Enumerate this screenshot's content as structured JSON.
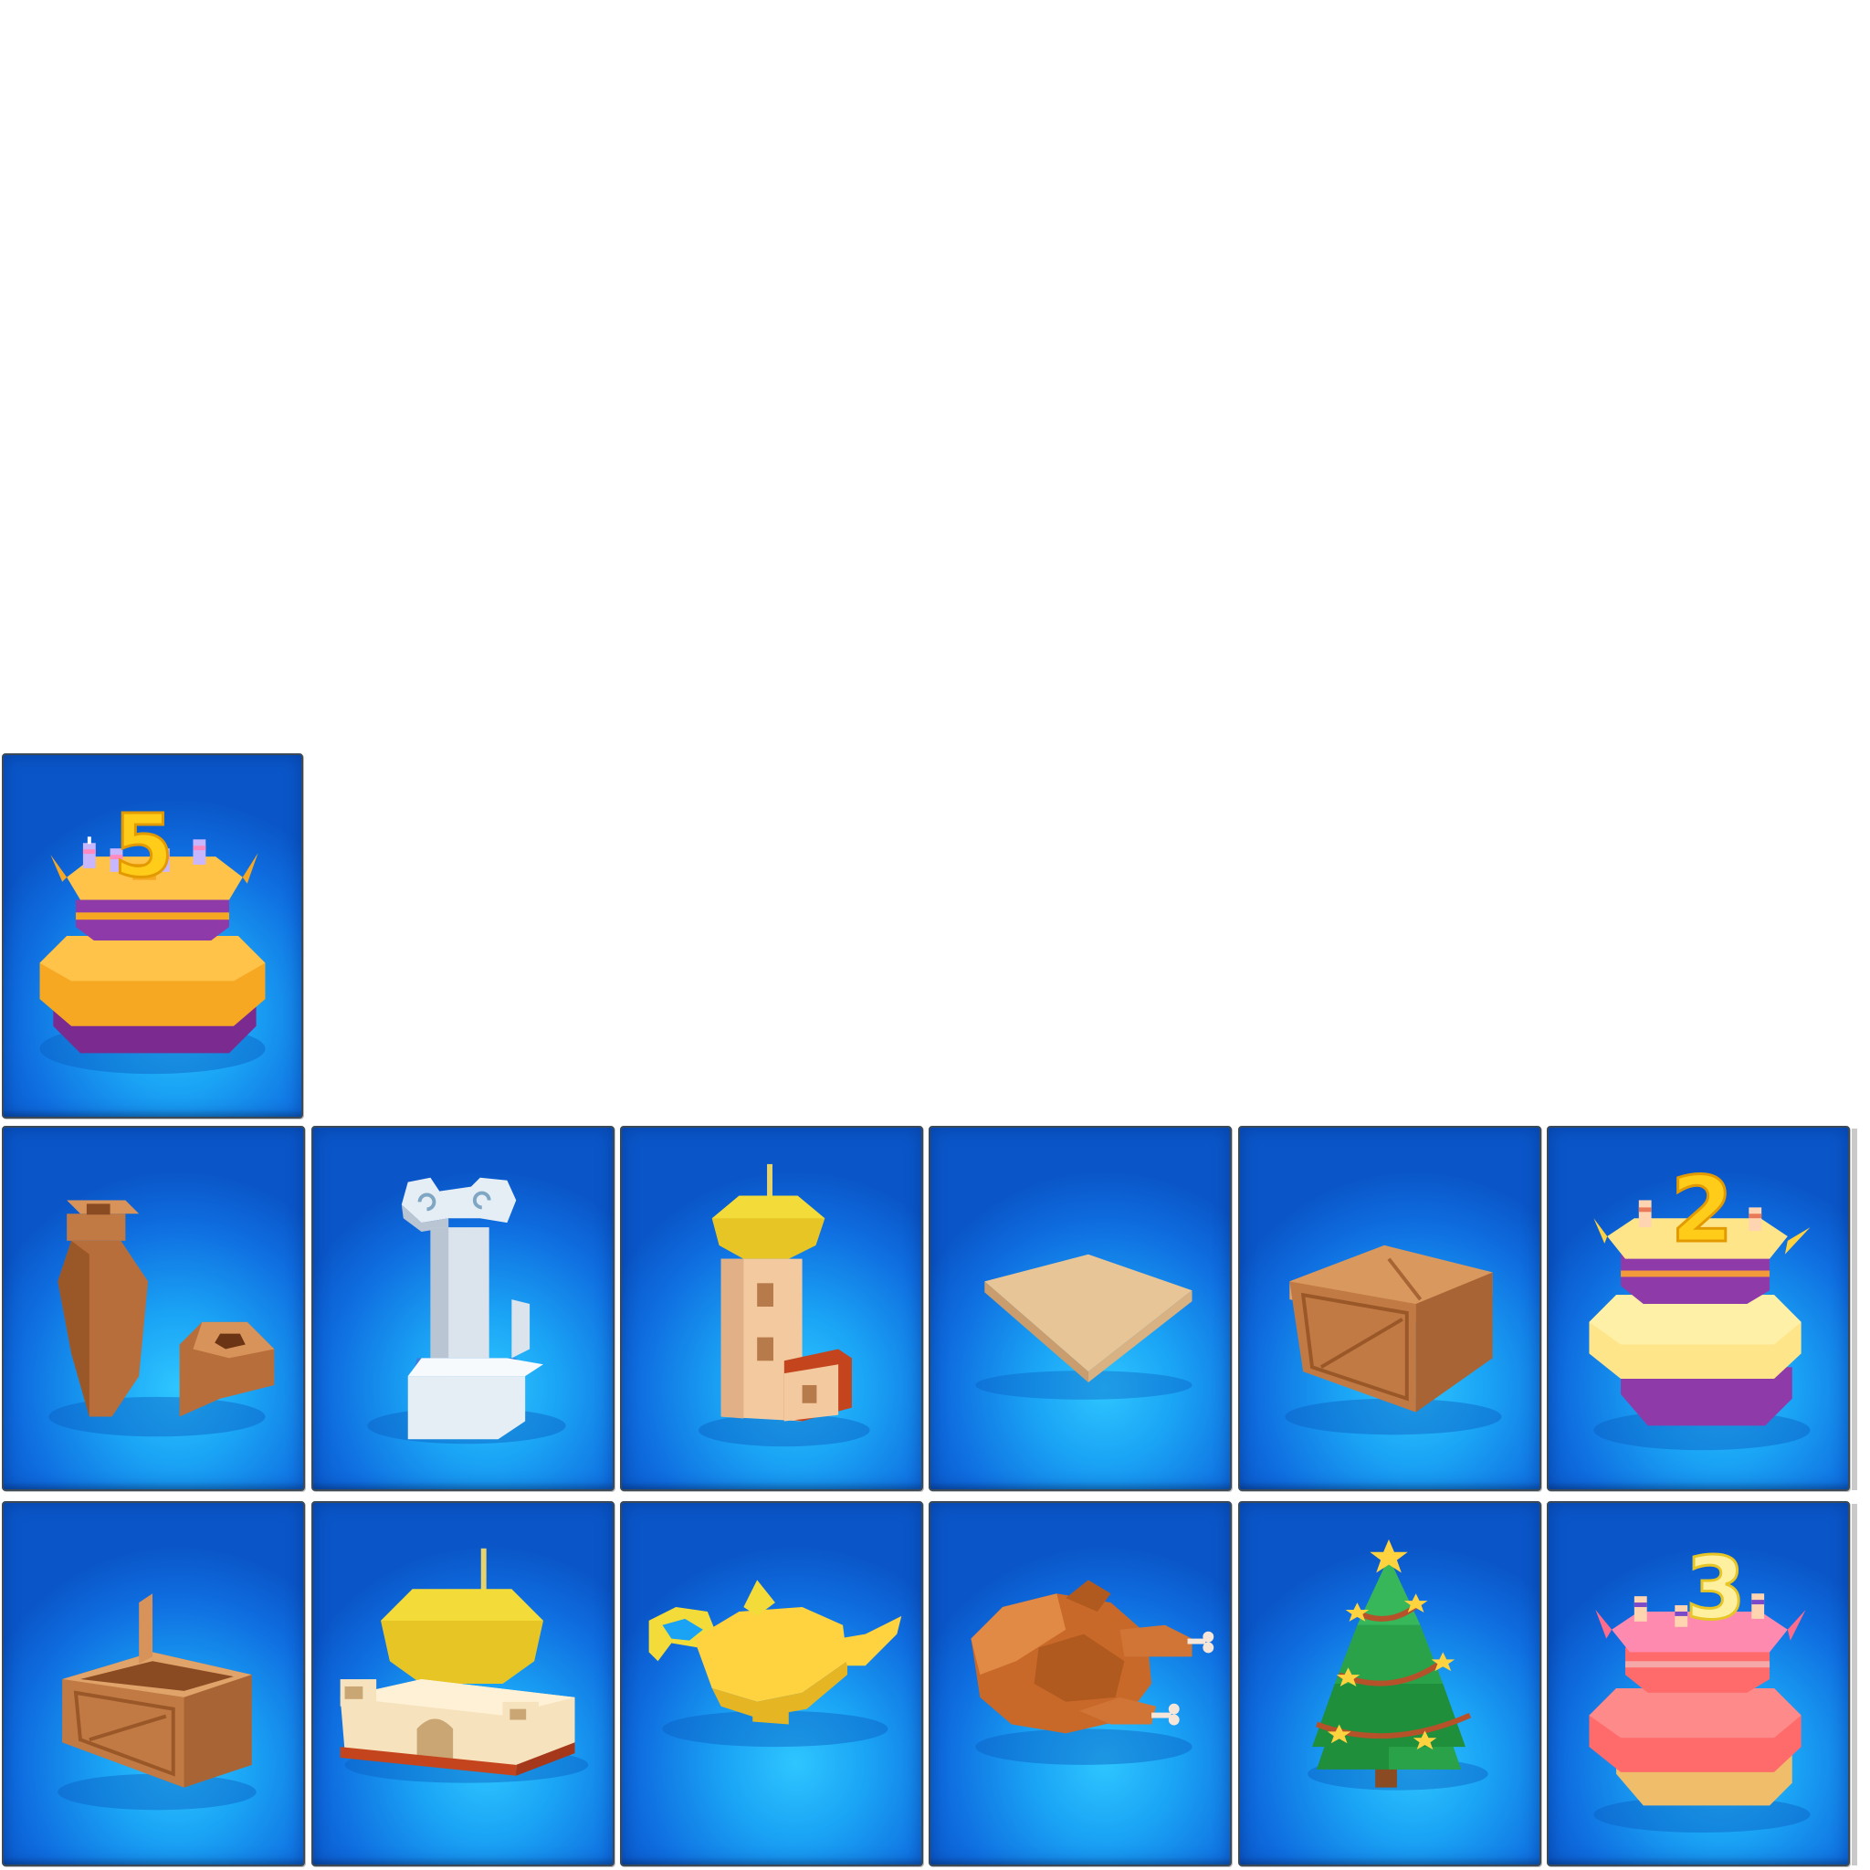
{
  "grid": {
    "background": "#ffffff",
    "card_colors": {
      "center": "#2ec6ff",
      "edge": "#0a56c8",
      "border": "#3c4a58"
    },
    "top_row": [
      {
        "icon": "birthday-cake-5-icon",
        "candle_number": "5"
      }
    ],
    "middle_row": [
      {
        "icon": "clay-vase-and-pot-icon"
      },
      {
        "icon": "marble-column-icon"
      },
      {
        "icon": "minaret-tower-icon"
      },
      {
        "icon": "flat-stone-slab-icon"
      },
      {
        "icon": "wooden-crate-icon"
      },
      {
        "icon": "birthday-cake-2-icon",
        "candle_number": "2"
      }
    ],
    "bottom_row": [
      {
        "icon": "open-wooden-crate-icon"
      },
      {
        "icon": "golden-dome-palace-icon"
      },
      {
        "icon": "magic-lamp-icon"
      },
      {
        "icon": "roast-turkey-icon"
      },
      {
        "icon": "christmas-tree-icon"
      },
      {
        "icon": "birthday-cake-3-icon",
        "candle_number": "3"
      }
    ]
  }
}
